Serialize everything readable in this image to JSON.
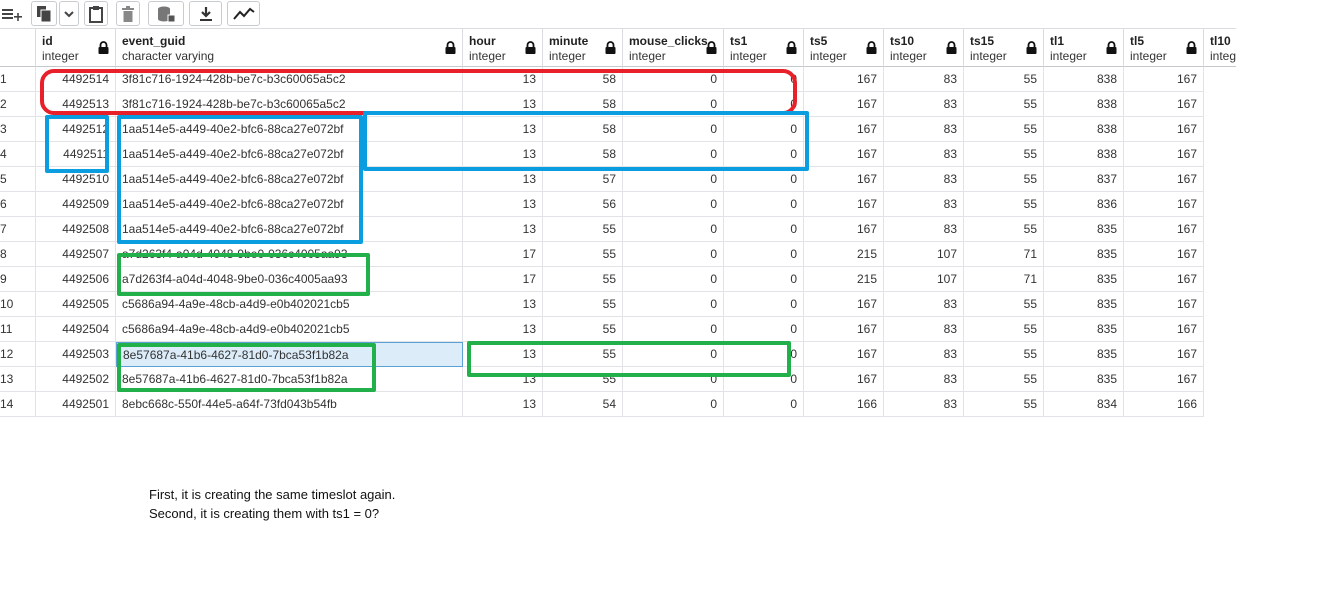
{
  "toolbar": {
    "buttons": [
      {
        "name": "add-row-icon"
      },
      {
        "name": "copy-icon"
      },
      {
        "name": "chevron-down-icon"
      },
      {
        "name": "paste-icon"
      },
      {
        "name": "delete-icon"
      },
      {
        "name": "save-data-icon"
      },
      {
        "name": "download-icon"
      },
      {
        "name": "graph-icon"
      }
    ]
  },
  "columns": [
    {
      "name": "id",
      "type": "integer"
    },
    {
      "name": "event_guid",
      "type": "character varying"
    },
    {
      "name": "hour",
      "type": "integer"
    },
    {
      "name": "minute",
      "type": "integer"
    },
    {
      "name": "mouse_clicks",
      "type": "integer"
    },
    {
      "name": "ts1",
      "type": "integer"
    },
    {
      "name": "ts5",
      "type": "integer"
    },
    {
      "name": "ts10",
      "type": "integer"
    },
    {
      "name": "ts15",
      "type": "integer"
    },
    {
      "name": "tl1",
      "type": "integer"
    },
    {
      "name": "tl5",
      "type": "integer"
    },
    {
      "name": "tl10",
      "type": "integer"
    }
  ],
  "rows": [
    [
      "1",
      "4492514",
      "3f81c716-1924-428b-be7c-b3c60065a5c2",
      "13",
      "58",
      "0",
      "0",
      "167",
      "83",
      "55",
      "838",
      "167"
    ],
    [
      "2",
      "4492513",
      "3f81c716-1924-428b-be7c-b3c60065a5c2",
      "13",
      "58",
      "0",
      "0",
      "167",
      "83",
      "55",
      "838",
      "167"
    ],
    [
      "3",
      "4492512",
      "1aa514e5-a449-40e2-bfc6-88ca27e072bf",
      "13",
      "58",
      "0",
      "0",
      "167",
      "83",
      "55",
      "838",
      "167"
    ],
    [
      "4",
      "4492511",
      "1aa514e5-a449-40e2-bfc6-88ca27e072bf",
      "13",
      "58",
      "0",
      "0",
      "167",
      "83",
      "55",
      "838",
      "167"
    ],
    [
      "5",
      "4492510",
      "1aa514e5-a449-40e2-bfc6-88ca27e072bf",
      "13",
      "57",
      "0",
      "0",
      "167",
      "83",
      "55",
      "837",
      "167"
    ],
    [
      "6",
      "4492509",
      "1aa514e5-a449-40e2-bfc6-88ca27e072bf",
      "13",
      "56",
      "0",
      "0",
      "167",
      "83",
      "55",
      "836",
      "167"
    ],
    [
      "7",
      "4492508",
      "1aa514e5-a449-40e2-bfc6-88ca27e072bf",
      "13",
      "55",
      "0",
      "0",
      "167",
      "83",
      "55",
      "835",
      "167"
    ],
    [
      "8",
      "4492507",
      "a7d263f4-a04d-4048-9be0-036c4005aa93",
      "17",
      "55",
      "0",
      "0",
      "215",
      "107",
      "71",
      "835",
      "167"
    ],
    [
      "9",
      "4492506",
      "a7d263f4-a04d-4048-9be0-036c4005aa93",
      "17",
      "55",
      "0",
      "0",
      "215",
      "107",
      "71",
      "835",
      "167"
    ],
    [
      "10",
      "4492505",
      "c5686a94-4a9e-48cb-a4d9-e0b402021cb5",
      "13",
      "55",
      "0",
      "0",
      "167",
      "83",
      "55",
      "835",
      "167"
    ],
    [
      "11",
      "4492504",
      "c5686a94-4a9e-48cb-a4d9-e0b402021cb5",
      "13",
      "55",
      "0",
      "0",
      "167",
      "83",
      "55",
      "835",
      "167"
    ],
    [
      "12",
      "4492503",
      "8e57687a-41b6-4627-81d0-7bca53f1b82a",
      "13",
      "55",
      "0",
      "0",
      "167",
      "83",
      "55",
      "835",
      "167"
    ],
    [
      "13",
      "4492502",
      "8e57687a-41b6-4627-81d0-7bca53f1b82a",
      "13",
      "55",
      "0",
      "0",
      "167",
      "83",
      "55",
      "835",
      "167"
    ],
    [
      "14",
      "4492501",
      "8ebc668c-550f-44e5-a64f-73fd043b54fb",
      "13",
      "54",
      "0",
      "0",
      "166",
      "83",
      "55",
      "834",
      "166"
    ]
  ],
  "selected_row": "12",
  "annotation_colors": {
    "red": "#e8202a",
    "blue": "#0a9ee0",
    "green": "#22b04a"
  },
  "notes": {
    "line1": "First, it is creating the same timeslot again.",
    "line2": "Second, it is creating them with ts1 = 0?"
  }
}
